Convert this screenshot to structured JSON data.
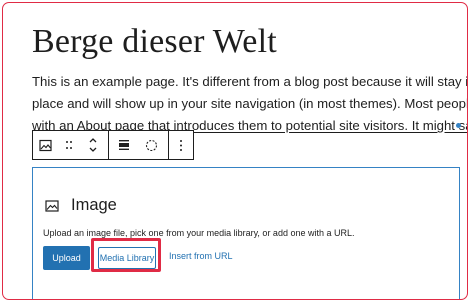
{
  "page": {
    "title": "Berge dieser Welt",
    "paragraph_lines": [
      "This is an example page. It's different from a blog post because it will stay in one",
      "place and will show up in your site navigation (in most themes). Most people start",
      "with an About page that introduces them to potential site visitors. It might say"
    ]
  },
  "toolbar": {
    "icons": [
      "image-icon",
      "drag-handle-icon",
      "move-up-down-icon",
      "align-icon",
      "circle-icon",
      "more-options-icon"
    ]
  },
  "image_block": {
    "title": "Image",
    "description": "Upload an image file, pick one from your media library, or add one with a URL.",
    "upload_label": "Upload",
    "media_library_label": "Media Library",
    "insert_url_label": "Insert from URL"
  },
  "colors": {
    "highlight": "#e02b45",
    "primary": "#2271b1",
    "focus_border": "#3582c4"
  }
}
